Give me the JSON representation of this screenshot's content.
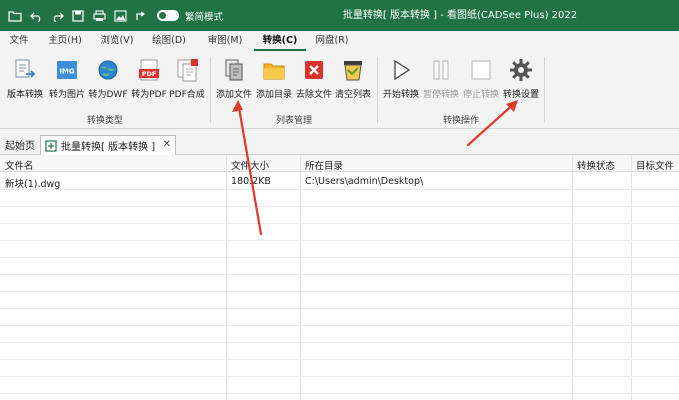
{
  "titlebar": {
    "toggle_label": "繁简模式",
    "window_title": "批量转换[ 版本转换 ] - 看图纸(CADSee Plus) 2022"
  },
  "menu": {
    "tabs": [
      "文件",
      "主页(H)",
      "浏览(V)",
      "绘图(D)",
      "审图(M)",
      "转换(C)",
      "网盘(R)"
    ],
    "active": "转换(C)"
  },
  "ribbon": {
    "group1": {
      "label": "转换类型",
      "buttons": [
        "版本转换",
        "转为图片",
        "转为DWF",
        "转为PDF",
        "PDF合成"
      ]
    },
    "group2": {
      "label": "列表管理",
      "buttons": [
        "添加文件",
        "添加目录",
        "去除文件",
        "清空列表"
      ]
    },
    "group3": {
      "label": "转换操作",
      "buttons": [
        "开始转换",
        "暂停转换",
        "停止转换",
        "转换设置"
      ]
    },
    "icon_texts": {
      "img": "IMG",
      "pdf": "PDF"
    }
  },
  "doctabs": {
    "start": "起始页",
    "active": "批量转换[ 版本转换 ]"
  },
  "table": {
    "columns": [
      "文件名",
      "文件大小",
      "所在目录",
      "转换状态",
      "目标文件"
    ],
    "rows": [
      {
        "name": "新块(1).dwg",
        "size": "180.2KB",
        "dir": "C:\\Users\\admin\\Desktop\\",
        "status": "",
        "target": ""
      }
    ]
  },
  "colors": {
    "brand": "#217346",
    "annotation": "#e03a2e"
  }
}
